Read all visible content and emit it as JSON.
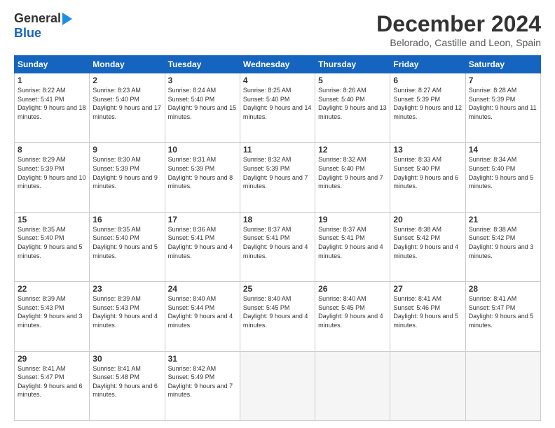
{
  "logo": {
    "general": "General",
    "blue": "Blue"
  },
  "header": {
    "month": "December 2024",
    "location": "Belorado, Castille and Leon, Spain"
  },
  "weekdays": [
    "Sunday",
    "Monday",
    "Tuesday",
    "Wednesday",
    "Thursday",
    "Friday",
    "Saturday"
  ],
  "weeks": [
    [
      {
        "day": "1",
        "sunrise": "8:22 AM",
        "sunset": "5:41 PM",
        "daylight": "9 hours and 18 minutes."
      },
      {
        "day": "2",
        "sunrise": "8:23 AM",
        "sunset": "5:40 PM",
        "daylight": "9 hours and 17 minutes."
      },
      {
        "day": "3",
        "sunrise": "8:24 AM",
        "sunset": "5:40 PM",
        "daylight": "9 hours and 15 minutes."
      },
      {
        "day": "4",
        "sunrise": "8:25 AM",
        "sunset": "5:40 PM",
        "daylight": "9 hours and 14 minutes."
      },
      {
        "day": "5",
        "sunrise": "8:26 AM",
        "sunset": "5:40 PM",
        "daylight": "9 hours and 13 minutes."
      },
      {
        "day": "6",
        "sunrise": "8:27 AM",
        "sunset": "5:39 PM",
        "daylight": "9 hours and 12 minutes."
      },
      {
        "day": "7",
        "sunrise": "8:28 AM",
        "sunset": "5:39 PM",
        "daylight": "9 hours and 11 minutes."
      }
    ],
    [
      {
        "day": "8",
        "sunrise": "8:29 AM",
        "sunset": "5:39 PM",
        "daylight": "9 hours and 10 minutes."
      },
      {
        "day": "9",
        "sunrise": "8:30 AM",
        "sunset": "5:39 PM",
        "daylight": "9 hours and 9 minutes."
      },
      {
        "day": "10",
        "sunrise": "8:31 AM",
        "sunset": "5:39 PM",
        "daylight": "9 hours and 8 minutes."
      },
      {
        "day": "11",
        "sunrise": "8:32 AM",
        "sunset": "5:39 PM",
        "daylight": "9 hours and 7 minutes."
      },
      {
        "day": "12",
        "sunrise": "8:32 AM",
        "sunset": "5:40 PM",
        "daylight": "9 hours and 7 minutes."
      },
      {
        "day": "13",
        "sunrise": "8:33 AM",
        "sunset": "5:40 PM",
        "daylight": "9 hours and 6 minutes."
      },
      {
        "day": "14",
        "sunrise": "8:34 AM",
        "sunset": "5:40 PM",
        "daylight": "9 hours and 5 minutes."
      }
    ],
    [
      {
        "day": "15",
        "sunrise": "8:35 AM",
        "sunset": "5:40 PM",
        "daylight": "9 hours and 5 minutes."
      },
      {
        "day": "16",
        "sunrise": "8:35 AM",
        "sunset": "5:40 PM",
        "daylight": "9 hours and 5 minutes."
      },
      {
        "day": "17",
        "sunrise": "8:36 AM",
        "sunset": "5:41 PM",
        "daylight": "9 hours and 4 minutes."
      },
      {
        "day": "18",
        "sunrise": "8:37 AM",
        "sunset": "5:41 PM",
        "daylight": "9 hours and 4 minutes."
      },
      {
        "day": "19",
        "sunrise": "8:37 AM",
        "sunset": "5:41 PM",
        "daylight": "9 hours and 4 minutes."
      },
      {
        "day": "20",
        "sunrise": "8:38 AM",
        "sunset": "5:42 PM",
        "daylight": "9 hours and 4 minutes."
      },
      {
        "day": "21",
        "sunrise": "8:38 AM",
        "sunset": "5:42 PM",
        "daylight": "9 hours and 3 minutes."
      }
    ],
    [
      {
        "day": "22",
        "sunrise": "8:39 AM",
        "sunset": "5:43 PM",
        "daylight": "9 hours and 3 minutes."
      },
      {
        "day": "23",
        "sunrise": "8:39 AM",
        "sunset": "5:43 PM",
        "daylight": "9 hours and 4 minutes."
      },
      {
        "day": "24",
        "sunrise": "8:40 AM",
        "sunset": "5:44 PM",
        "daylight": "9 hours and 4 minutes."
      },
      {
        "day": "25",
        "sunrise": "8:40 AM",
        "sunset": "5:45 PM",
        "daylight": "9 hours and 4 minutes."
      },
      {
        "day": "26",
        "sunrise": "8:40 AM",
        "sunset": "5:45 PM",
        "daylight": "9 hours and 4 minutes."
      },
      {
        "day": "27",
        "sunrise": "8:41 AM",
        "sunset": "5:46 PM",
        "daylight": "9 hours and 5 minutes."
      },
      {
        "day": "28",
        "sunrise": "8:41 AM",
        "sunset": "5:47 PM",
        "daylight": "9 hours and 5 minutes."
      }
    ],
    [
      {
        "day": "29",
        "sunrise": "8:41 AM",
        "sunset": "5:47 PM",
        "daylight": "9 hours and 6 minutes."
      },
      {
        "day": "30",
        "sunrise": "8:41 AM",
        "sunset": "5:48 PM",
        "daylight": "9 hours and 6 minutes."
      },
      {
        "day": "31",
        "sunrise": "8:42 AM",
        "sunset": "5:49 PM",
        "daylight": "9 hours and 7 minutes."
      },
      null,
      null,
      null,
      null
    ]
  ]
}
